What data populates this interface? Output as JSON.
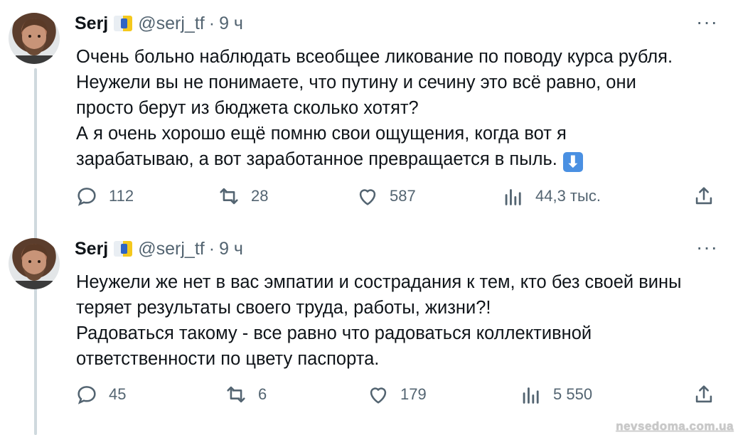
{
  "tweets": [
    {
      "author": {
        "name": "Serj",
        "handle": "@serj_tf",
        "dot": "·",
        "time": "9 ч"
      },
      "more": "···",
      "text": "Очень больно наблюдать всеобщее ликование по поводу курса рубля.\nНеужели вы не понимаете, что путину и сечину это всё равно, они\nпросто берут из бюджета сколько хотят?\nА я очень хорошо ещё помню свои ощущения, когда вот я\nзарабатываю, а вот заработанное превращается в пыль.",
      "emoji": "⬇",
      "stats": {
        "replies": "112",
        "reposts": "28",
        "likes": "587",
        "views": "44,3 тыс."
      }
    },
    {
      "author": {
        "name": "Serj",
        "handle": "@serj_tf",
        "dot": "·",
        "time": "9 ч"
      },
      "more": "···",
      "text": "Неужели же нет в вас эмпатии и сострадания к тем, кто без своей вины\nтеряет результаты своего труда, работы, жизни?!\nРадоваться такому - все равно что радоваться коллективной\nответственности по цвету паспорта.",
      "stats": {
        "replies": "45",
        "reposts": "6",
        "likes": "179",
        "views": "5 550"
      }
    }
  ],
  "icons": [
    "reply-icon",
    "repost-icon",
    "like-icon",
    "views-icon",
    "share-icon"
  ],
  "watermark": "nevsedoma.com.ua"
}
